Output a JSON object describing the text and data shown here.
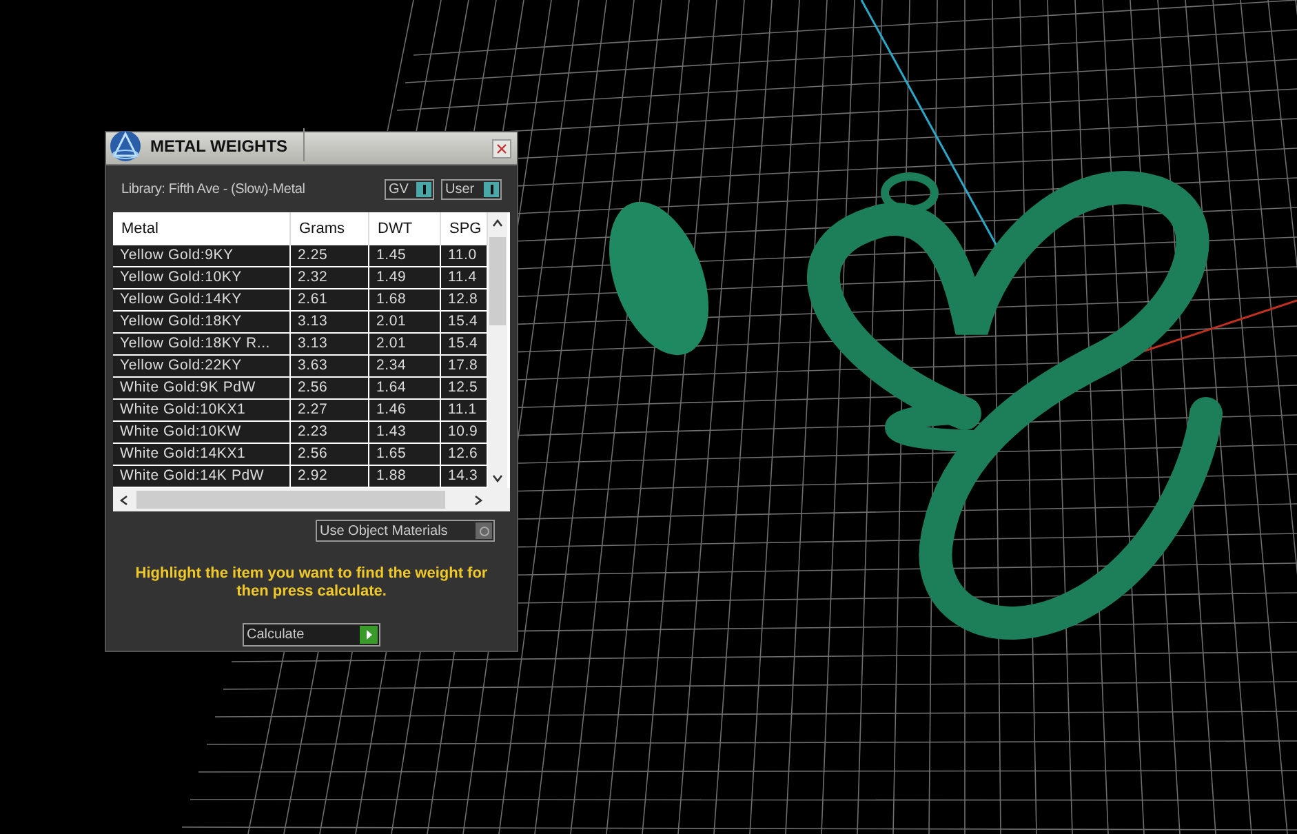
{
  "window": {
    "title": "METAL WEIGHTS"
  },
  "library": "Library: Fifth Ave - (Slow)-Metal",
  "toggles": [
    {
      "label": "GV",
      "on": true
    },
    {
      "label": "User",
      "on": true
    }
  ],
  "table": {
    "columns": [
      "Metal",
      "Grams",
      "DWT",
      "SPG"
    ],
    "rows": [
      {
        "cells": [
          "Yellow Gold:9KY",
          "2.25",
          "1.45",
          "11.0"
        ]
      },
      {
        "cells": [
          "Yellow Gold:10KY",
          "2.32",
          "1.49",
          "11.4"
        ]
      },
      {
        "cells": [
          "Yellow Gold:14KY",
          "2.61",
          "1.68",
          "12.8"
        ]
      },
      {
        "cells": [
          "Yellow Gold:18KY",
          "3.13",
          "2.01",
          "15.4"
        ]
      },
      {
        "cells": [
          "Yellow Gold:18KY R...",
          "3.13",
          "2.01",
          "15.4"
        ]
      },
      {
        "cells": [
          "Yellow Gold:22KY",
          "3.63",
          "2.34",
          "17.8"
        ]
      },
      {
        "cells": [
          "White Gold:9K PdW",
          "2.56",
          "1.64",
          "12.5"
        ]
      },
      {
        "cells": [
          "White Gold:10KX1",
          "2.27",
          "1.46",
          "11.1"
        ]
      },
      {
        "cells": [
          "White Gold:10KW",
          "2.23",
          "1.43",
          "10.9"
        ]
      },
      {
        "cells": [
          "White Gold:14KX1",
          "2.56",
          "1.65",
          "12.6"
        ]
      },
      {
        "cells": [
          "White Gold:14K PdW",
          "2.92",
          "1.88",
          "14.3"
        ]
      }
    ]
  },
  "use_object_materials": {
    "label": "Use Object Materials",
    "on": false
  },
  "instruction": "Highlight the item you want to find the weight for then press calculate.",
  "calculate_button": "Calculate"
}
